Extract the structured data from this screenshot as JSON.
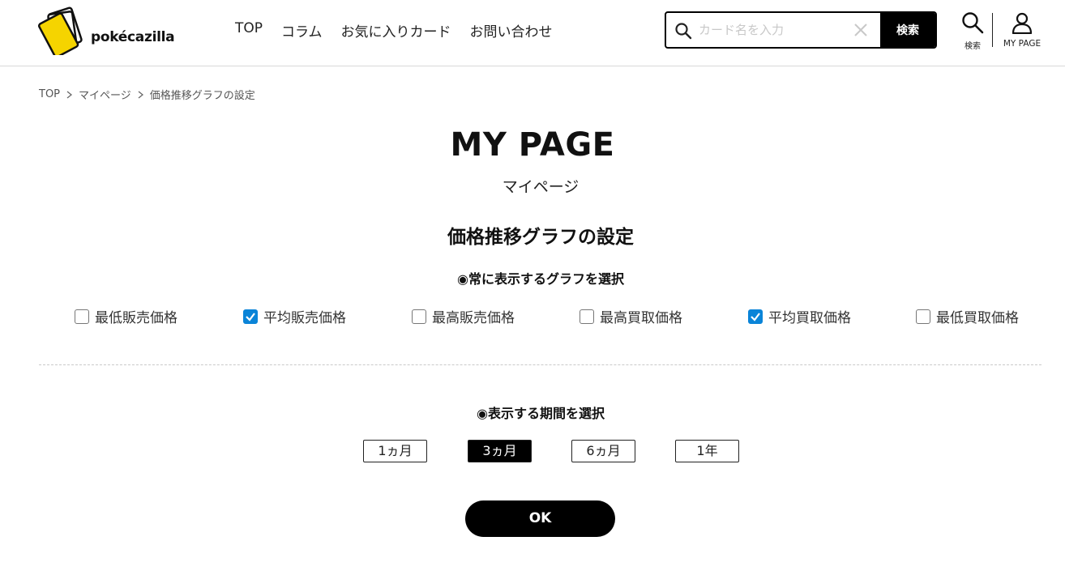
{
  "header": {
    "logo_text": "pokécazilla",
    "nav": [
      "TOP",
      "コラム",
      "お気に入りカード",
      "お問い合わせ"
    ],
    "search": {
      "placeholder": "カード名を入力",
      "value": "",
      "button_label": "検索"
    },
    "search_icon_label": "検索",
    "mypage_label": "MY PAGE"
  },
  "breadcrumb": [
    "TOP",
    "マイページ",
    "価格推移グラフの設定"
  ],
  "main": {
    "title": "MY PAGE",
    "subtitle": "マイページ",
    "section_title": "価格推移グラフの設定",
    "graph_heading": "◉常に表示するグラフを選択",
    "checkboxes": [
      {
        "label": "最低販売価格",
        "checked": false
      },
      {
        "label": "平均販売価格",
        "checked": true
      },
      {
        "label": "最高販売価格",
        "checked": false
      },
      {
        "label": "最高買取価格",
        "checked": false
      },
      {
        "label": "平均買取価格",
        "checked": true
      },
      {
        "label": "最低買取価格",
        "checked": false
      }
    ],
    "period_heading": "◉表示する期間を選択",
    "periods": [
      {
        "label": "1ヵ月",
        "active": false
      },
      {
        "label": "3ヵ月",
        "active": true
      },
      {
        "label": "6ヵ月",
        "active": false
      },
      {
        "label": "1年",
        "active": false
      }
    ],
    "ok_label": "OK"
  },
  "colors": {
    "accent_yellow": "#f5d400",
    "checkbox_blue": "#0a84d8",
    "black": "#000000"
  }
}
